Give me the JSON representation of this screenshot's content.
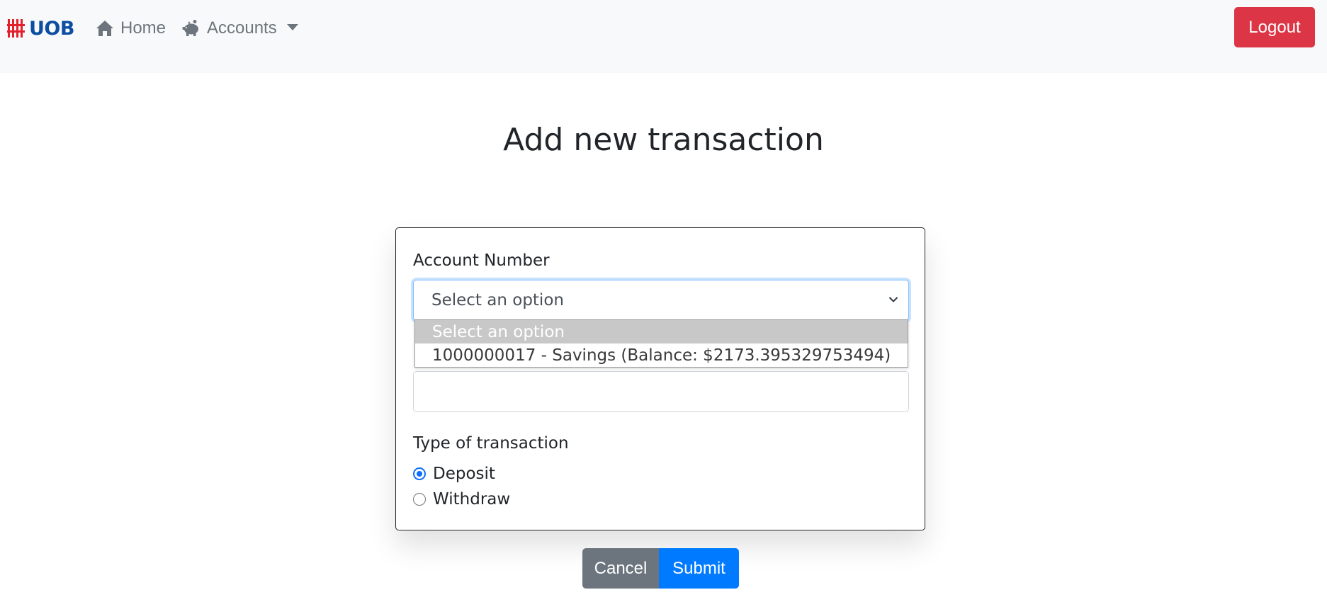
{
  "navbar": {
    "brand": "UOB",
    "links": {
      "home": "Home",
      "accounts": "Accounts"
    },
    "logout_label": "Logout"
  },
  "page": {
    "title": "Add new transaction"
  },
  "form": {
    "account_label": "Account Number",
    "account_select_value": "Select an option",
    "account_options": [
      "Select an option",
      "1000000017 - Savings (Balance: $2173.395329753494)"
    ],
    "amount_value": "",
    "type_label": "Type of transaction",
    "type_options": [
      {
        "label": "Deposit",
        "checked": true
      },
      {
        "label": "Withdraw",
        "checked": false
      }
    ]
  },
  "actions": {
    "cancel_label": "Cancel",
    "submit_label": "Submit"
  },
  "colors": {
    "brand_blue": "#0b4ea2",
    "brand_red": "#e4202c",
    "logout_red": "#dc3545",
    "submit_blue": "#007bff",
    "cancel_gray": "#6c757d"
  },
  "icons": {
    "home": "home-icon",
    "accounts": "piggy-bank-icon",
    "select": "chevron-down-icon"
  }
}
